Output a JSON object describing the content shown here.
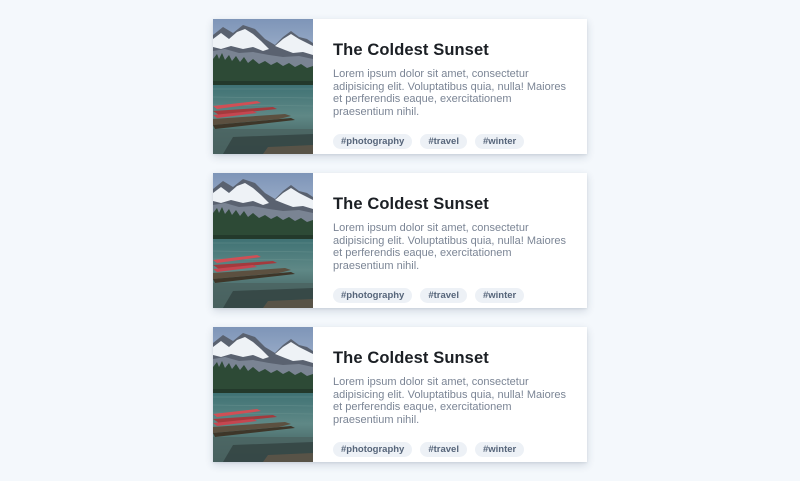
{
  "cards": [
    {
      "title": "The Coldest Sunset",
      "description": "Lorem ipsum dolor sit amet, consectetur adipisicing elit. Voluptatibus quia, nulla! Maiores et perferendis eaque, exercitationem praesentium nihil.",
      "image": "mountain-lake-canoes-photo",
      "tags": [
        "#photography",
        "#travel",
        "#winter"
      ]
    },
    {
      "title": "The Coldest Sunset",
      "description": "Lorem ipsum dolor sit amet, consectetur adipisicing elit. Voluptatibus quia, nulla! Maiores et perferendis eaque, exercitationem praesentium nihil.",
      "image": "mountain-lake-canoes-photo",
      "tags": [
        "#photography",
        "#travel",
        "#winter"
      ]
    },
    {
      "title": "The Coldest Sunset",
      "description": "Lorem ipsum dolor sit amet, consectetur adipisicing elit. Voluptatibus quia, nulla! Maiores et perferendis eaque, exercitationem praesentium nihil.",
      "image": "mountain-lake-canoes-photo",
      "tags": [
        "#photography",
        "#travel",
        "#winter"
      ]
    }
  ]
}
